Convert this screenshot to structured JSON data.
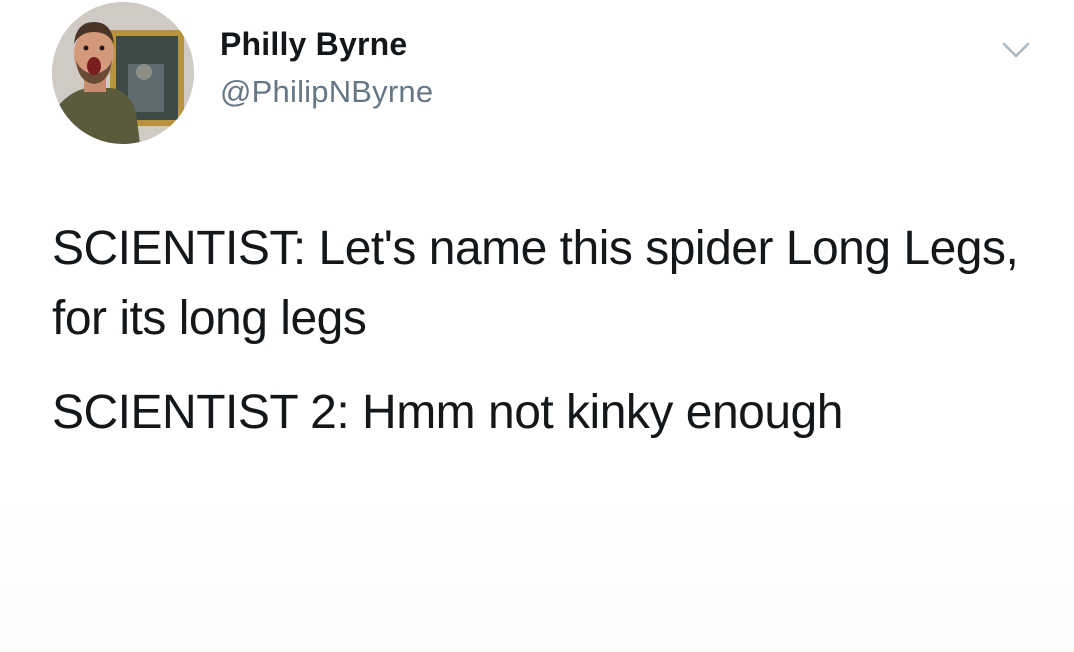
{
  "tweet": {
    "author": {
      "display_name": "Philly Byrne",
      "handle": "@PhilipNByrne",
      "avatar_icon": "profile-photo"
    },
    "menu_icon": "chevron-down-icon",
    "paragraphs": [
      "SCIENTIST: Let's name this spider Long Legs, for its long legs",
      "SCIENTIST 2: Hmm not kinky enough"
    ]
  },
  "colors": {
    "text": "#14171a",
    "secondary_text": "#657786",
    "caret": "#aab8c2",
    "background": "#ffffff"
  }
}
